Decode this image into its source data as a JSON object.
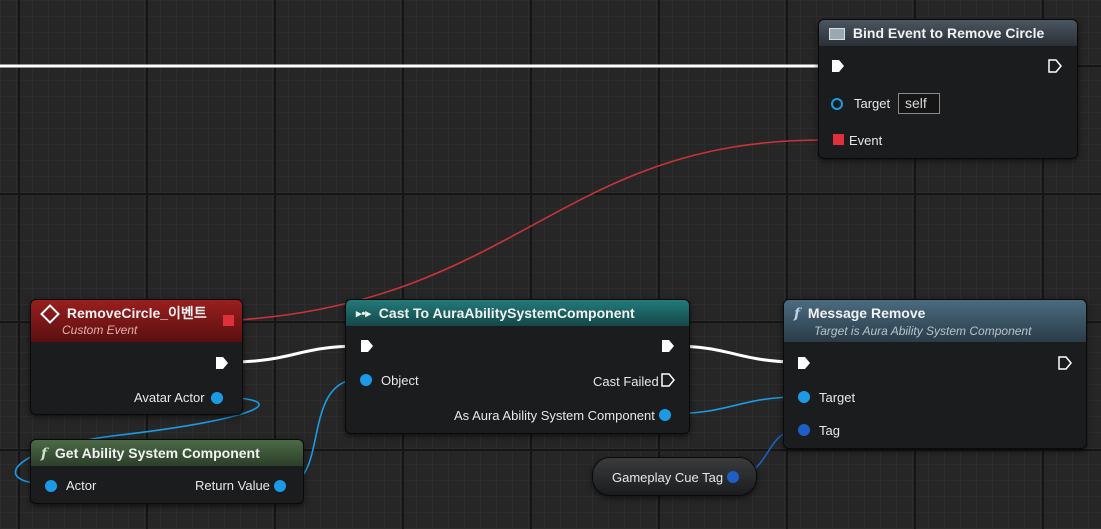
{
  "graph": {
    "nodes": {
      "bind_event": {
        "title": "Bind Event to Remove Circle",
        "target_label": "Target",
        "target_value": "self",
        "event_label": "Event"
      },
      "custom_event": {
        "title": "RemoveCircle_이벤트",
        "subtitle": "Custom Event",
        "avatar_actor_label": "Avatar Actor"
      },
      "cast": {
        "title": "Cast To AuraAbilitySystemComponent",
        "object_label": "Object",
        "cast_failed_label": "Cast Failed",
        "as_label": "As Aura Ability System Component"
      },
      "message_remove": {
        "title": "Message Remove",
        "subtitle": "Target is Aura Ability System Component",
        "target_label": "Target",
        "tag_label": "Tag"
      },
      "get_asc": {
        "title": "Get Ability System Component",
        "actor_label": "Actor",
        "return_label": "Return Value"
      },
      "gameplay_cue_tag": {
        "label": "Gameplay Cue Tag"
      }
    },
    "colors": {
      "event_header": "#8a1a1a",
      "cast_header": "#1f6e6e",
      "function_header": "#3e5d70",
      "pure_function_header": "#3d5a3a",
      "exec_wire": "#ffffff",
      "object_wire": "#1b9be6",
      "delegate_wire": "#d23a3a"
    }
  }
}
